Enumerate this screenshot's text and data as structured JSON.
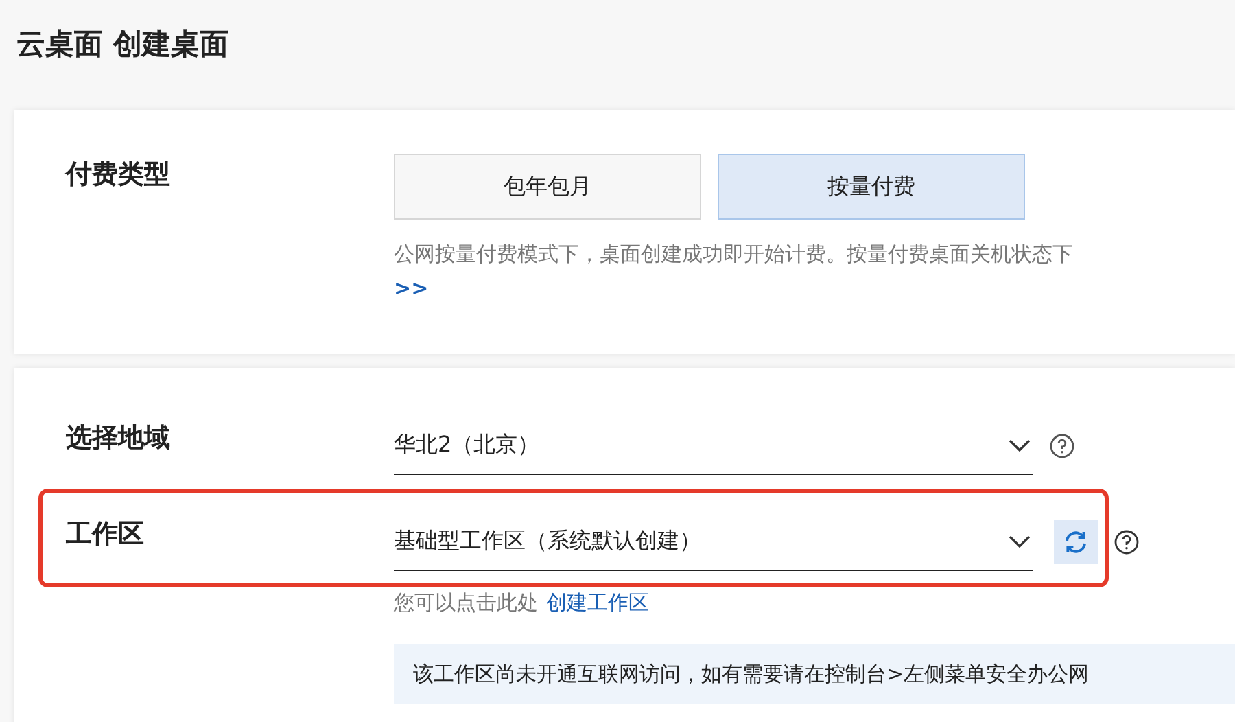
{
  "title": "云桌面 创建桌面",
  "billing": {
    "label": "付费类型",
    "options": [
      {
        "label": "包年包月",
        "selected": false
      },
      {
        "label": "按量付费",
        "selected": true
      }
    ],
    "note": "公网按量付费模式下，桌面创建成功即开始计费。按量付费桌面关机状态下",
    "more_link": ">>"
  },
  "region": {
    "label": "选择地域",
    "value": "华北2（北京）"
  },
  "workspace": {
    "label": "工作区",
    "value": "基础型工作区（系统默认创建）",
    "highlighted": true,
    "hint": "您可以点击此处",
    "link": "创建工作区",
    "notice": "该工作区尚未开通互联网访问，如有需要请在控制台>左侧菜单安全办公网"
  }
}
